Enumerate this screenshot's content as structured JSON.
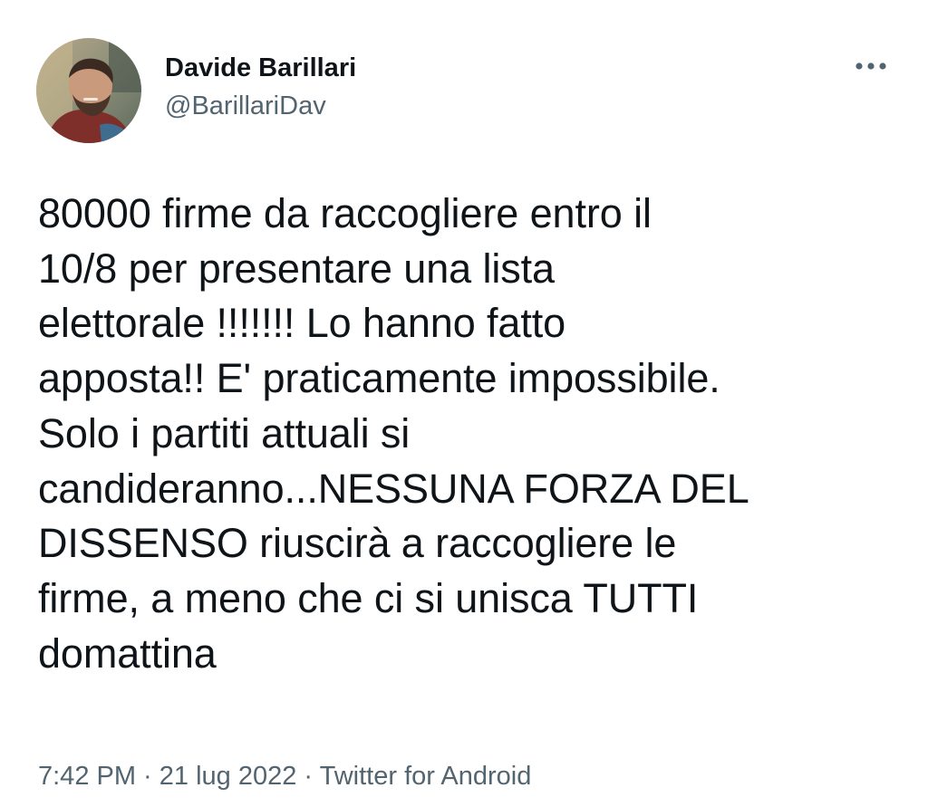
{
  "author": {
    "display_name": "Davide Barillari",
    "handle": "@BarillariDav",
    "avatar_icon": "profile-photo"
  },
  "more_icon": "more-horizontal-icon",
  "tweet": {
    "text": "80000 firme da raccogliere entro il\n10/8 per presentare una lista\nelettorale !!!!!!! Lo hanno fatto\napposta!! E' praticamente impossibile.\nSolo i partiti attuali si\ncandideranno...NESSUNA FORZA DEL\nDISSENSO riuscirà a raccogliere le\nfirme, a meno che ci si unisca TUTTI\ndomattina"
  },
  "meta": {
    "time": "7:42 PM",
    "separator": " · ",
    "date": "21 lug 2022",
    "source": "Twitter for Android"
  },
  "colors": {
    "text_primary": "#0f1419",
    "text_secondary": "#536471",
    "background": "#ffffff"
  }
}
